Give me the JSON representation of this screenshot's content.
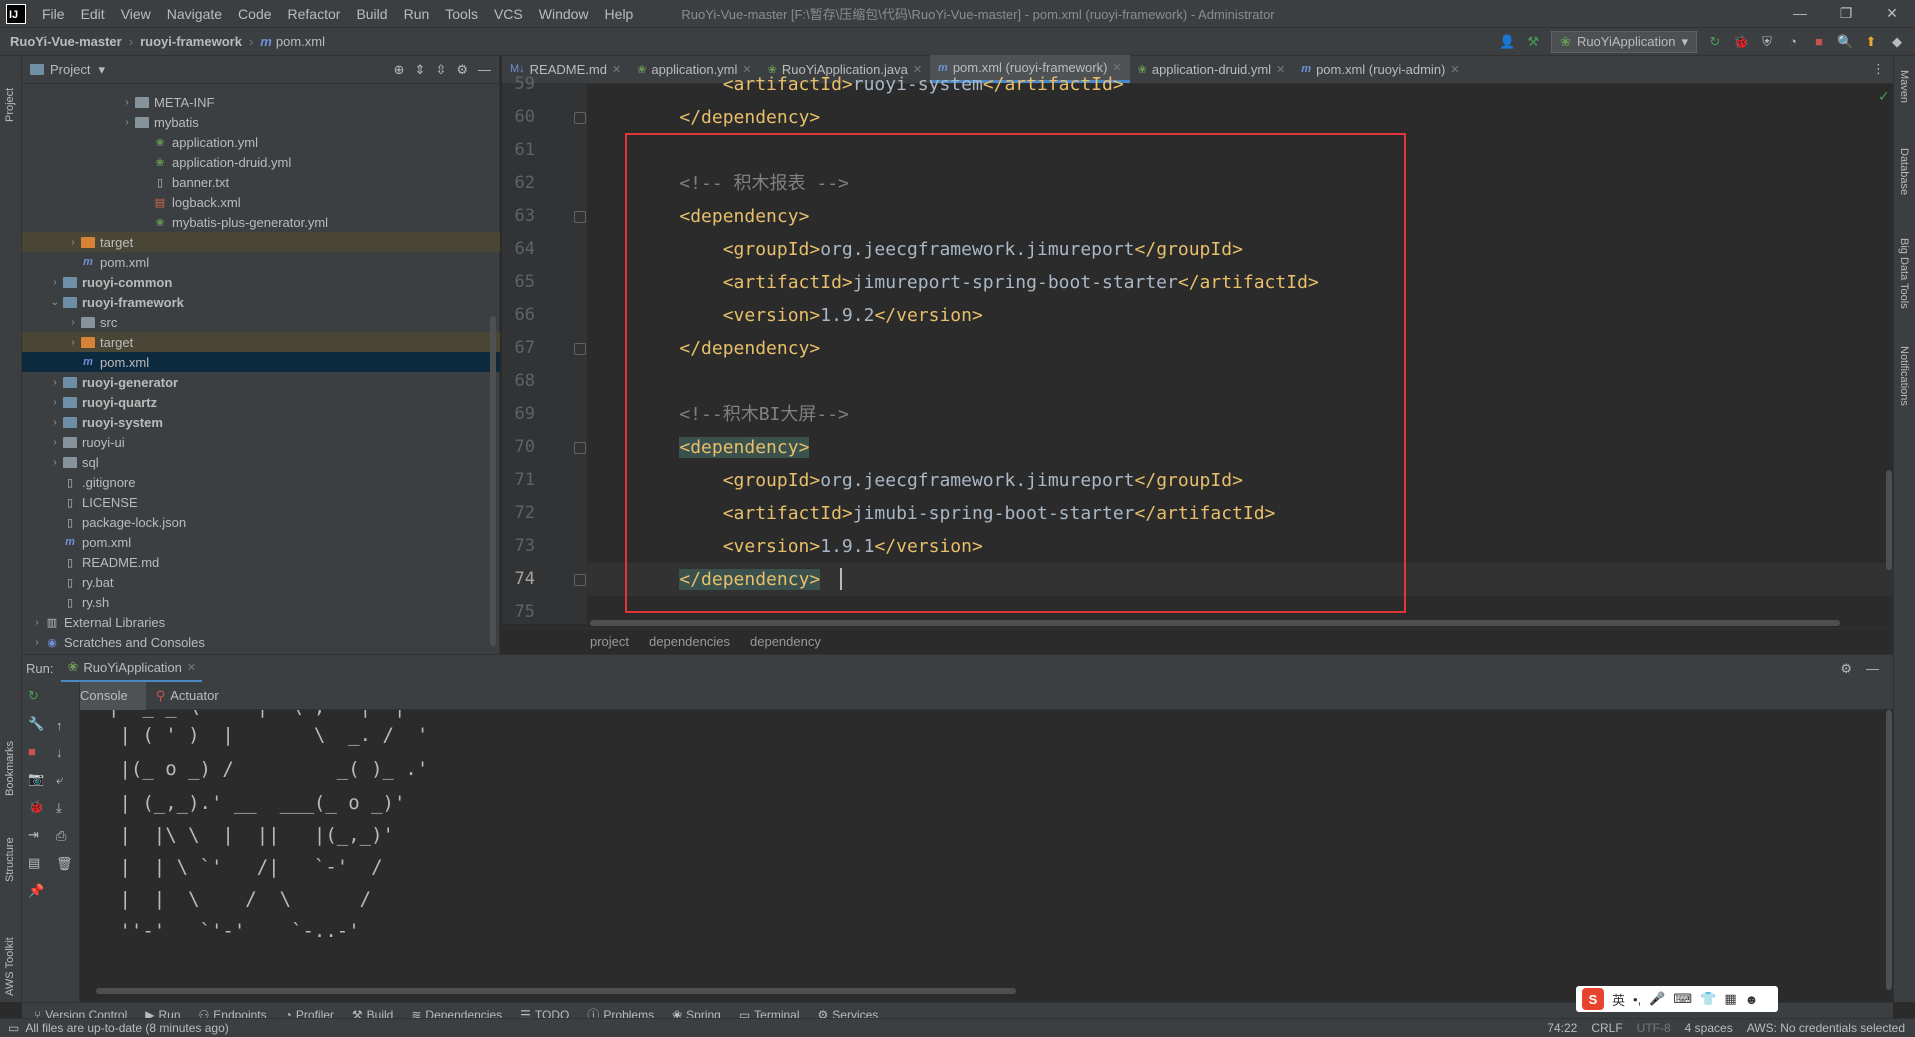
{
  "titlebar": {
    "menus": [
      "File",
      "Edit",
      "View",
      "Navigate",
      "Code",
      "Refactor",
      "Build",
      "Run",
      "Tools",
      "VCS",
      "Window",
      "Help"
    ],
    "window_title": "RuoYi-Vue-master [F:\\暂存\\压缩包\\代码\\RuoYi-Vue-master] - pom.xml (ruoyi-framework) - Administrator"
  },
  "navbar": {
    "crumbs": [
      "RuoYi-Vue-master",
      "ruoyi-framework",
      "pom.xml"
    ],
    "run_config": "RuoYiApplication"
  },
  "project": {
    "title": "Project",
    "rows": [
      {
        "label": "META-INF",
        "indent": 5
      },
      {
        "label": "mybatis",
        "indent": 5
      },
      {
        "label": "application.yml",
        "indent": 6
      },
      {
        "label": "application-druid.yml",
        "indent": 6
      },
      {
        "label": "banner.txt",
        "indent": 6
      },
      {
        "label": "logback.xml",
        "indent": 6
      },
      {
        "label": "mybatis-plus-generator.yml",
        "indent": 6
      },
      {
        "label": "target",
        "indent": 2
      },
      {
        "label": "pom.xml",
        "indent": 2
      },
      {
        "label": "ruoyi-common",
        "indent": 1
      },
      {
        "label": "ruoyi-framework",
        "indent": 1
      },
      {
        "label": "src",
        "indent": 2
      },
      {
        "label": "target",
        "indent": 2
      },
      {
        "label": "pom.xml",
        "indent": 2
      },
      {
        "label": "ruoyi-generator",
        "indent": 1
      },
      {
        "label": "ruoyi-quartz",
        "indent": 1
      },
      {
        "label": "ruoyi-system",
        "indent": 1
      },
      {
        "label": "ruoyi-ui",
        "indent": 1
      },
      {
        "label": "sql",
        "indent": 1
      },
      {
        "label": ".gitignore",
        "indent": 1
      },
      {
        "label": "LICENSE",
        "indent": 1
      },
      {
        "label": "package-lock.json",
        "indent": 1
      },
      {
        "label": "pom.xml",
        "indent": 1
      },
      {
        "label": "README.md",
        "indent": 1
      },
      {
        "label": "ry.bat",
        "indent": 1
      },
      {
        "label": "ry.sh",
        "indent": 1
      },
      {
        "label": "External Libraries",
        "indent": 0
      },
      {
        "label": "Scratches and Consoles",
        "indent": 0
      }
    ]
  },
  "tabs": [
    "README.md",
    "application.yml",
    "RuoYiApplication.java",
    "pom.xml (ruoyi-framework)",
    "application-druid.yml",
    "pom.xml (ruoyi-admin)"
  ],
  "editor": {
    "line_numbers": [
      "59",
      "60",
      "61",
      "62",
      "63",
      "64",
      "65",
      "66",
      "67",
      "68",
      "69",
      "70",
      "71",
      "72",
      "73",
      "74",
      "75"
    ],
    "lines": {
      "l59": "        <artifactId>ruoyi-system</artifactId>",
      "l60": "    </dependency>",
      "l61": "",
      "l62": "    <!-- 积木报表 -->",
      "l63": "    <dependency>",
      "l64": "        <groupId>org.jeecgframework.jimureport</groupId>",
      "l65": "        <artifactId>jimureport-spring-boot-starter</artifactId>",
      "l66": "        <version>1.9.2</version>",
      "l67": "    </dependency>",
      "l68": "",
      "l69": "    <!--积木BI大屏-->",
      "l70": "    <dependency>",
      "l71": "        <groupId>org.jeecgframework.jimureport</groupId>",
      "l72": "        <artifactId>jimubi-spring-boot-starter</artifactId>",
      "l73": "        <version>1.9.1</version>",
      "l74": "    </dependency>",
      "l75": ""
    },
    "breadcrumb": [
      "project",
      "dependencies",
      "dependency"
    ]
  },
  "run": {
    "label": "Run:",
    "config": "RuoYiApplication",
    "tabs": [
      "Console",
      "Actuator"
    ],
    "console_lines": [
      " | ( ' )  |       \\  _. /  '",
      " |(_ o _) /         _( )_ .'",
      " | (_,_).' __  ___(_ o _)'",
      " |  |\\ \\  |  ||   |(_,_)'",
      " |  | \\ `'   /|   `-'  /",
      " |  |  \\    /  \\      /",
      " ''-'   `'-'    `-..-'"
    ]
  },
  "bottom_tools": [
    "Version Control",
    "Run",
    "Endpoints",
    "Profiler",
    "Build",
    "Dependencies",
    "TODO",
    "Problems",
    "Spring",
    "Terminal",
    "Services"
  ],
  "left_stripe": [
    "Project",
    "Bookmarks",
    "Structure",
    "AWS Toolkit"
  ],
  "right_stripe": [
    "Maven",
    "Database",
    "Big Data Tools",
    "Notifications"
  ],
  "status": {
    "message": "All files are up-to-date (8 minutes ago)",
    "position": "74:22",
    "line_sep": "CRLF",
    "encoding": "UTF-8",
    "indent": "4 spaces",
    "aws": "AWS: No credentials selected"
  },
  "ime": {
    "lang": "英"
  }
}
